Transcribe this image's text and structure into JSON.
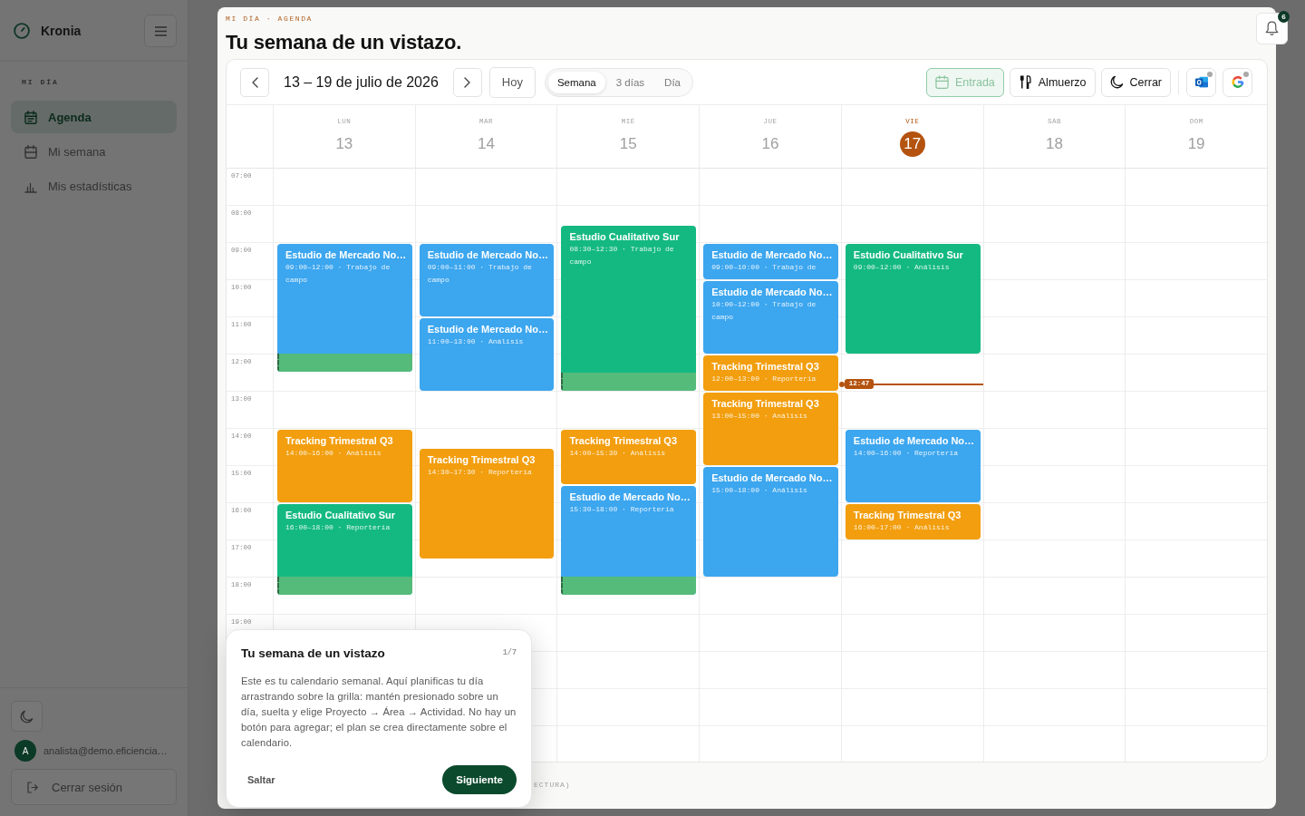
{
  "sidebar": {
    "brand": "Kronia",
    "section_label": "MI DÍA",
    "items": [
      {
        "kind": "agenda",
        "label": "Agenda",
        "selected": true
      },
      {
        "kind": "week",
        "label": "Mi semana",
        "selected": false
      },
      {
        "kind": "stats",
        "label": "Mis estadísticas",
        "selected": false
      }
    ],
    "user": {
      "initial": "A",
      "email": "analista@demo.eficiencia…"
    },
    "logout": "Cerrar sesión"
  },
  "main": {
    "breadcrumb": "MI DÍA · AGENDA",
    "title": "Tu semana de un vistazo.",
    "notification_count": "6",
    "calendar": {
      "range_label": "13 – 19 de julio de 2026",
      "today_button": "Hoy",
      "views": [
        {
          "label": "Semana",
          "selected": true
        },
        {
          "label": "3 días",
          "selected": false
        },
        {
          "label": "Día",
          "selected": false
        }
      ],
      "actions": [
        {
          "kind": "entry",
          "label": "Entrada",
          "disabled": true
        },
        {
          "kind": "lunch",
          "label": "Almuerzo",
          "disabled": false
        },
        {
          "kind": "close",
          "label": "Cerrar",
          "disabled": false
        }
      ],
      "integrations": [
        {
          "kind": "outlook",
          "connected": false
        },
        {
          "kind": "google",
          "connected": false
        }
      ],
      "hours": [
        "07:00",
        "08:00",
        "09:00",
        "10:00",
        "11:00",
        "12:00",
        "13:00",
        "14:00",
        "15:00",
        "16:00",
        "17:00",
        "18:00",
        "19:00"
      ],
      "now": "12:47",
      "days": [
        {
          "abbr": "LUN",
          "number": "13",
          "today": false,
          "events": [
            {
              "title": "Estudio de Mercado No…",
              "detail": "09:00–12:00 · Trabajo de campo",
              "color": "#3ca6ef",
              "overrun": true
            },
            {
              "title": "Tracking Trimestral Q3",
              "detail": "14:00–16:00 · Análisis",
              "color": "#f29e0e",
              "overrun": false
            },
            {
              "title": "Estudio Cualitativo Sur",
              "detail": "16:00–18:00 · Reportería",
              "color": "#14b982",
              "overrun": true
            }
          ]
        },
        {
          "abbr": "MAR",
          "number": "14",
          "today": false,
          "events": [
            {
              "title": "Estudio de Mercado No…",
              "detail": "09:00–11:00 · Trabajo de campo",
              "color": "#3ca6ef",
              "overrun": false
            },
            {
              "title": "Estudio de Mercado No…",
              "detail": "11:00–13:00 · Análisis",
              "color": "#3ca6ef",
              "overrun": false
            },
            {
              "title": "Tracking Trimestral Q3",
              "detail": "14:30–17:30 · Reportería",
              "color": "#f29e0e",
              "overrun": false
            }
          ]
        },
        {
          "abbr": "MIÉ",
          "number": "15",
          "today": false,
          "events": [
            {
              "title": "Estudio Cualitativo Sur",
              "detail": "08:30–12:30 · Trabajo de campo",
              "color": "#14b982",
              "overrun": true
            },
            {
              "title": "Tracking Trimestral Q3",
              "detail": "14:00–15:30 · Análisis",
              "color": "#f29e0e",
              "overrun": false
            },
            {
              "title": "Estudio de Mercado No…",
              "detail": "15:30–18:00 · Reportería",
              "color": "#3ca6ef",
              "overrun": true
            }
          ]
        },
        {
          "abbr": "JUE",
          "number": "16",
          "today": false,
          "events": [
            {
              "title": "Estudio de Mercado No…",
              "detail": "09:00–10:00 · Trabajo de",
              "color": "#3ca6ef",
              "overrun": false
            },
            {
              "title": "Estudio de Mercado No…",
              "detail": "10:00–12:00 · Trabajo de campo",
              "color": "#3ca6ef",
              "overrun": false
            },
            {
              "title": "Tracking Trimestral Q3",
              "detail": "12:00–13:00 · Reportería",
              "color": "#f29e0e",
              "overrun": false
            },
            {
              "title": "Tracking Trimestral Q3",
              "detail": "13:00–15:00 · Análisis",
              "color": "#f29e0e",
              "overrun": false
            },
            {
              "title": "Estudio de Mercado No…",
              "detail": "15:00–18:00 · Análisis",
              "color": "#3ca6ef",
              "overrun": false
            }
          ]
        },
        {
          "abbr": "VIE",
          "number": "17",
          "today": true,
          "events": [
            {
              "title": "Estudio Cualitativo Sur",
              "detail": "09:00–12:00 · Análisis",
              "color": "#14b982",
              "overrun": false
            },
            {
              "title": "Estudio de Mercado No…",
              "detail": "14:00–16:00 · Reportería",
              "color": "#3ca6ef",
              "overrun": false
            },
            {
              "title": "Tracking Trimestral Q3",
              "detail": "16:00–17:00 · Análisis",
              "color": "#f29e0e",
              "overrun": false
            }
          ]
        },
        {
          "abbr": "SÁB",
          "number": "18",
          "today": false
        },
        {
          "abbr": "DOM",
          "number": "19",
          "today": false
        }
      ]
    },
    "footer_note": "ECTURA)"
  },
  "tour": {
    "title": "Tu semana de un vistazo",
    "step": "1/7",
    "body": "Este es tu calendario semanal. Aquí planificas tu día arrastrando sobre la grilla: mantén presionado sobre un día, suelta y elige Proyecto → Área → Actividad. No hay un botón para agregar; el plan se crea directamente sobre el calendario.",
    "skip": "Saltar",
    "next": "Siguiente"
  }
}
